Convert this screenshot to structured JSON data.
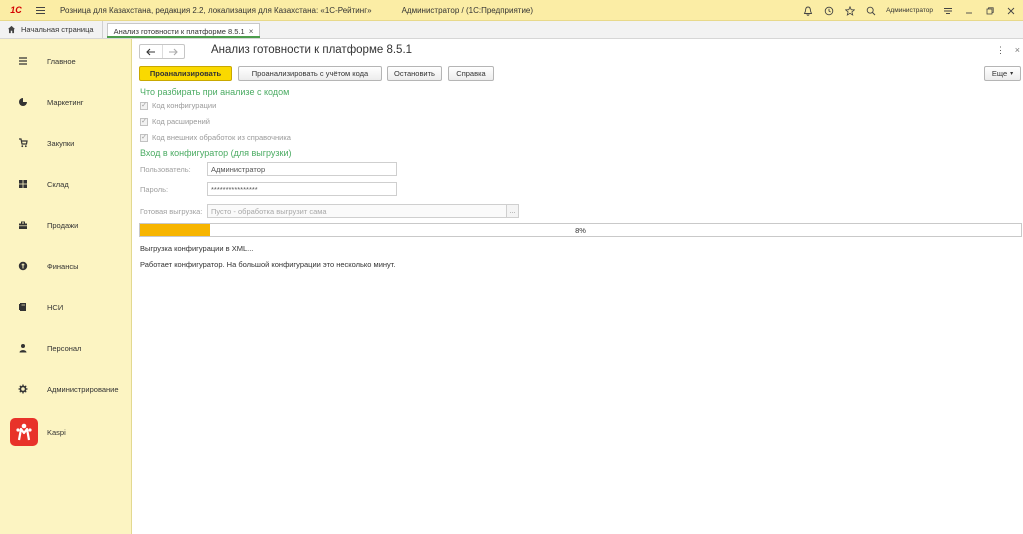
{
  "window": {
    "title": "Розница для Казахстана, редакция 2.2, локализация для Казахстана: «1С-Рейтинг»",
    "user_context": "Администратор / (1С:Предприятие)",
    "logo_text": "1С",
    "user_short": "Администратор"
  },
  "tabs": {
    "home_label": "Начальная страница",
    "active_label": "Анализ готовности к платформе 8.5.1",
    "close_glyph": "×"
  },
  "sidebar": {
    "items": [
      {
        "label": "Главное",
        "icon": "hamburger-icon"
      },
      {
        "label": "Маркетинг",
        "icon": "pie-chart-icon"
      },
      {
        "label": "Закупки",
        "icon": "purchases-icon"
      },
      {
        "label": "Склад",
        "icon": "warehouse-icon"
      },
      {
        "label": "Продажи",
        "icon": "sales-icon"
      },
      {
        "label": "Финансы",
        "icon": "finance-icon"
      },
      {
        "label": "НСИ",
        "icon": "reference-icon"
      },
      {
        "label": "Персонал",
        "icon": "person-icon"
      },
      {
        "label": "Администрирование",
        "icon": "gear-icon"
      },
      {
        "label": "Kaspi",
        "icon": "kaspi-logo"
      }
    ]
  },
  "form": {
    "title": "Анализ готовности к платформе 8.5.1",
    "buttons": {
      "analyze": "Проанализировать",
      "analyze_code": "Проанализировать с учётом кода",
      "stop": "Остановить",
      "help": "Справка",
      "more": "Еще"
    },
    "section_code": {
      "title": "Что разбирать при анализе с кодом",
      "options": [
        {
          "label": "Код конфигурации",
          "checked": true
        },
        {
          "label": "Код расширений",
          "checked": true
        },
        {
          "label": "Код внешних обработок из справочника",
          "checked": true
        }
      ]
    },
    "section_login": {
      "title": "Вход в конфигуратор (для выгрузки)",
      "user_label": "Пользователь:",
      "user_value": "Администратор",
      "password_label": "Пароль:",
      "password_value": "****************",
      "export_label": "Готовая выгрузка:",
      "export_placeholder": "Пусто - обработка выгрузит сама",
      "export_button": "..."
    },
    "progress": {
      "percent": 8,
      "text": "8%"
    },
    "status": {
      "line1": "Выгрузка конфигурации в XML...",
      "line2": "Работает конфигуратор. На большой конфигурации это несколько минут."
    }
  },
  "colors": {
    "titlebar_bg": "#fbeda5",
    "sidebar_bg": "#fcf4c2",
    "primary_button": "#fad900",
    "section_title": "#4aab62",
    "progress_fill": "#f7b500",
    "kaspi_red": "#e8322a"
  }
}
